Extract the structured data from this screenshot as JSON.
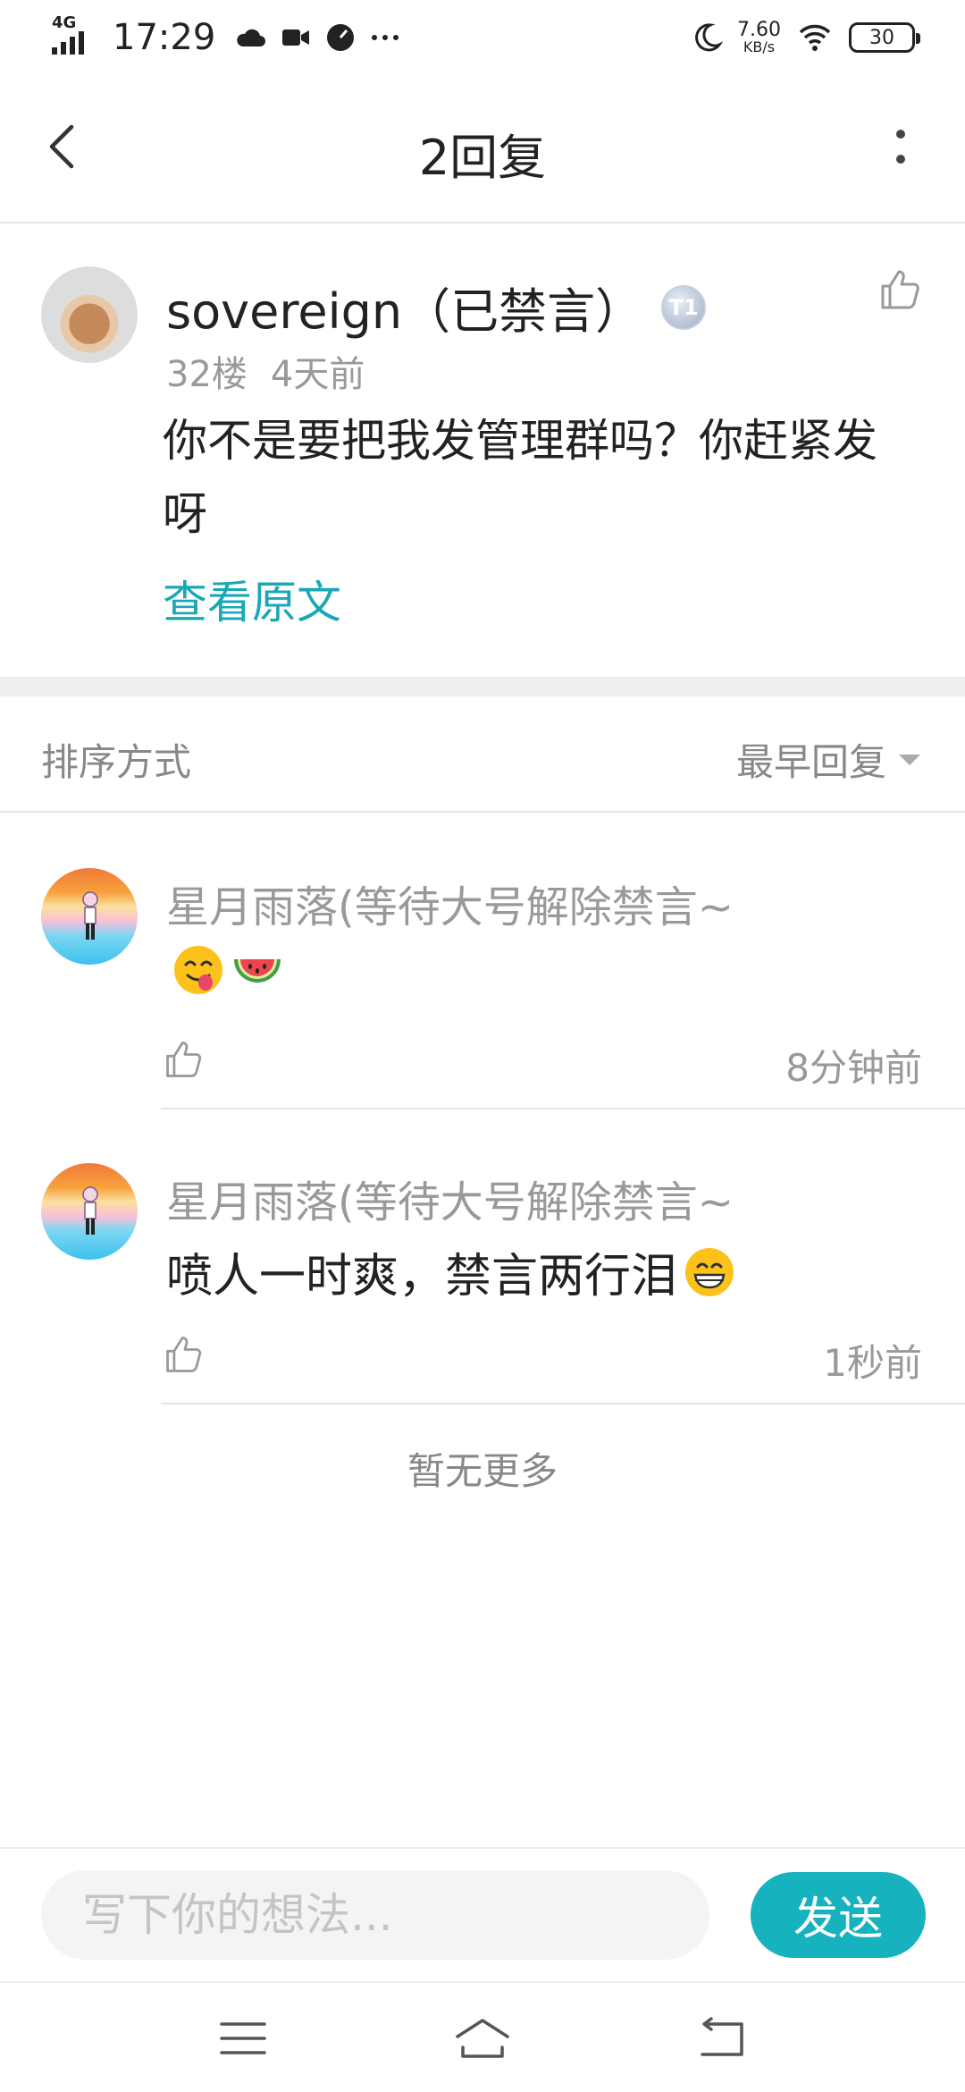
{
  "status_bar": {
    "network": "4G",
    "time": "17:29",
    "speed_value": "7.60",
    "speed_unit": "KB/s",
    "battery": "30",
    "icons": [
      "signal-icon",
      "cloud-icon",
      "video-icon",
      "speedometer-icon",
      "more-dots-icon",
      "moon-icon",
      "wifi-icon",
      "battery-icon"
    ]
  },
  "nav": {
    "title": "2回复",
    "back_icon": "back-arrow-icon",
    "more_icon": "more-vertical-icon"
  },
  "post": {
    "username": "sovereign（已禁言）",
    "badge": "T1",
    "floor": "32楼",
    "time": "4天前",
    "content": "你不是要把我发管理群吗？你赶紧发呀",
    "view_original": "查看原文"
  },
  "sort": {
    "label": "排序方式",
    "value": "最早回复"
  },
  "replies": [
    {
      "name": "星月雨落(等待大号解除禁言~",
      "text": "",
      "emojis": [
        "yum-emoji",
        "watermelon-emoji"
      ],
      "time": "8分钟前"
    },
    {
      "name": "星月雨落(等待大号解除禁言~",
      "text": "喷人一时爽，禁言两行泪",
      "emojis": [
        "grin-emoji"
      ],
      "time": "1秒前"
    }
  ],
  "footer_note": "暂无更多",
  "composer": {
    "placeholder": "写下你的想法...",
    "send_label": "发送"
  },
  "colors": {
    "accent": "#16b3be",
    "link": "#1aa8b4",
    "meta_gray": "#999999"
  }
}
